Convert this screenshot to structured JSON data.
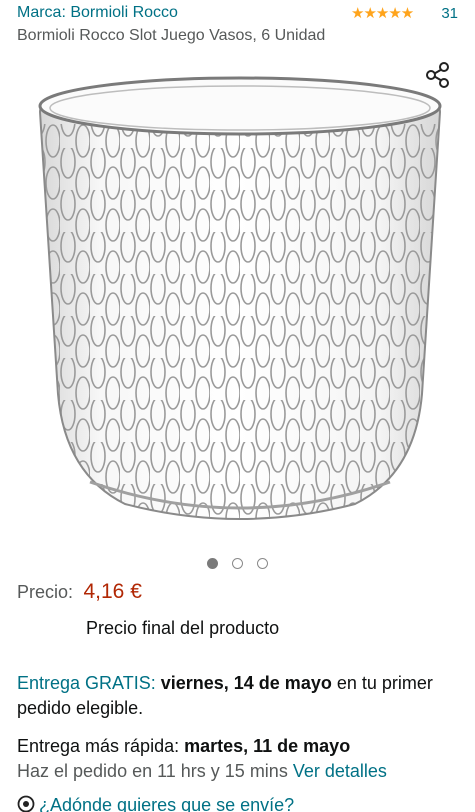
{
  "brand": {
    "label": "Marca: Bormioli Rocco"
  },
  "rating": {
    "stars_text": "★★★★★",
    "count": "31",
    "star_color": "#ffa41c"
  },
  "product": {
    "title": "Bormioli Rocco Slot Juego Vasos, 6 Unidad"
  },
  "icons": {
    "share": "share-icon",
    "location": "location-pin-icon"
  },
  "carousel": {
    "total": 3,
    "active": 1
  },
  "price": {
    "label": "Precio:",
    "value": "4,16 €",
    "note": "Precio final del producto",
    "color": "#b12704"
  },
  "delivery": {
    "prefix": "Entrega GRATIS:",
    "date": "viernes, 14 de mayo",
    "suffix": " en tu primer pedido elegible."
  },
  "fast_delivery": {
    "prefix": "Entrega más rápida: ",
    "date": "martes, 11 de mayo",
    "countdown": "Haz el pedido en 11 hrs y 15 mins ",
    "details_link": "Ver detalles"
  },
  "location": {
    "label": "¿Adónde quieres que se envíe?"
  },
  "colors": {
    "link": "#007185",
    "text": "#0f1111",
    "secondary": "#565959"
  }
}
